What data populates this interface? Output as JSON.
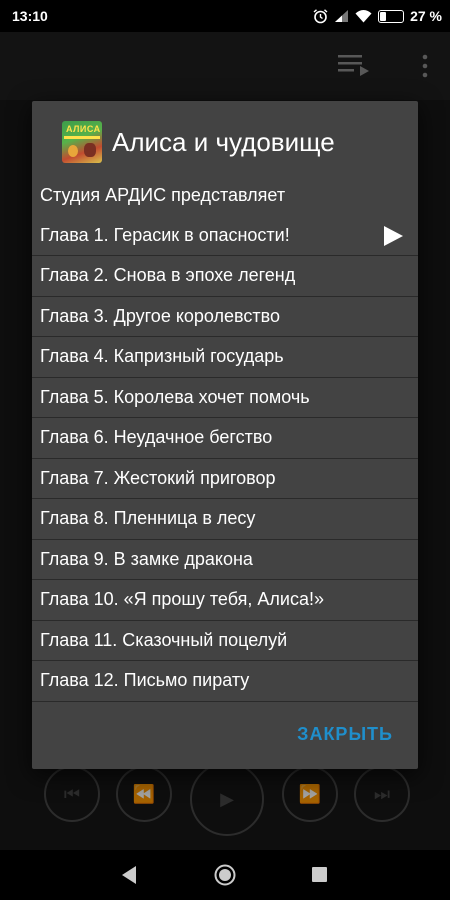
{
  "status_bar": {
    "time": "13:10",
    "battery_percent": "27 %",
    "battery_level": 0.27,
    "icons": [
      "alarm-icon",
      "signal-icon",
      "wifi-icon",
      "battery-icon"
    ]
  },
  "dialog": {
    "title": "Алиса и чудовище",
    "cover_text": "АЛИСА",
    "intro": "Студия АРДИС представляет",
    "chapters": [
      "Глава 1. Герасик в опасности!",
      "Глава 2. Снова в эпохе легенд",
      "Глава 3. Другое королевство",
      "Глава 4. Капризный государь",
      "Глава 5. Королева хочет помочь",
      "Глава 6. Неудачное бегство",
      "Глава 7. Жестокий приговор",
      "Глава 8. Пленница в лесу",
      "Глава 9. В замке дракона",
      "Глава 10. «Я прошу тебя, Алиса!»",
      "Глава 11. Сказочный поцелуй",
      "Глава 12. Письмо пирату"
    ],
    "playing_index": 0,
    "close_label": "ЗАКРЫТЬ"
  },
  "colors": {
    "dialog_bg": "#434343",
    "accent": "#1f8fcc",
    "divider": "#2a2a2a"
  }
}
